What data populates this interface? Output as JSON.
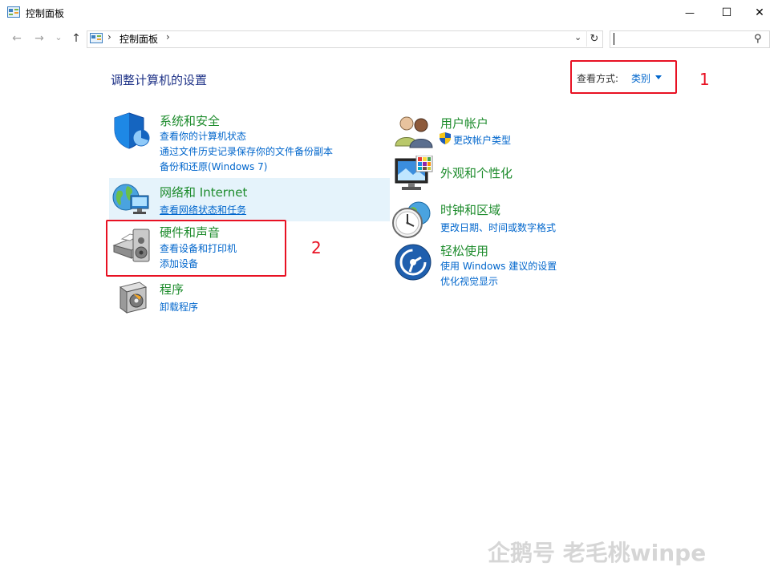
{
  "window": {
    "title": "控制面板",
    "minimize_glyph": "—",
    "maximize_glyph": "☐",
    "close_glyph": "✕"
  },
  "nav": {
    "back_glyph": "←",
    "forward_glyph": "→",
    "recent_glyph": "⌄",
    "up_glyph": "↑",
    "breadcrumb_separator": "›",
    "address_text": "控制面板",
    "address_separator_end": "›",
    "dropdown_glyph": "⌄",
    "refresh_glyph": "↻",
    "search_value": "",
    "search_icon_glyph": "⚲"
  },
  "main": {
    "heading": "调整计算机的设置",
    "view_by_label": "查看方式:",
    "view_by_value": "类别"
  },
  "annotations": {
    "label1": "1",
    "label2": "2",
    "color": "#e81123"
  },
  "categories_left": [
    {
      "title": "系统和安全",
      "icon": "shield-icon",
      "links": [
        "查看你的计算机状态",
        "通过文件历史记录保存你的文件备份副本",
        "备份和还原(Windows 7)"
      ]
    },
    {
      "title": "网络和 Internet",
      "icon": "network-globe-icon",
      "links": [
        "查看网络状态和任务"
      ]
    },
    {
      "title": "硬件和声音",
      "icon": "printer-speaker-icon",
      "links": [
        "查看设备和打印机",
        "添加设备"
      ]
    },
    {
      "title": "程序",
      "icon": "program-disc-icon",
      "links": [
        "卸载程序"
      ]
    }
  ],
  "categories_right": [
    {
      "title": "用户帐户",
      "icon": "users-icon",
      "links": [
        "更改帐户类型"
      ]
    },
    {
      "title": "外观和个性化",
      "icon": "monitor-palette-icon",
      "links": []
    },
    {
      "title": "时钟和区域",
      "icon": "clock-globe-icon",
      "links": [
        "更改日期、时间或数字格式"
      ]
    },
    {
      "title": "轻松使用",
      "icon": "ease-of-access-icon",
      "links": [
        "使用 Windows 建议的设置",
        "优化视觉显示"
      ]
    }
  ],
  "watermark": "企鹅号 老毛桃winpe",
  "colors": {
    "category_title": "#1e8c2d",
    "link": "#0066cc",
    "heading": "#1e3287",
    "hover_band": "#e5f3fb"
  }
}
